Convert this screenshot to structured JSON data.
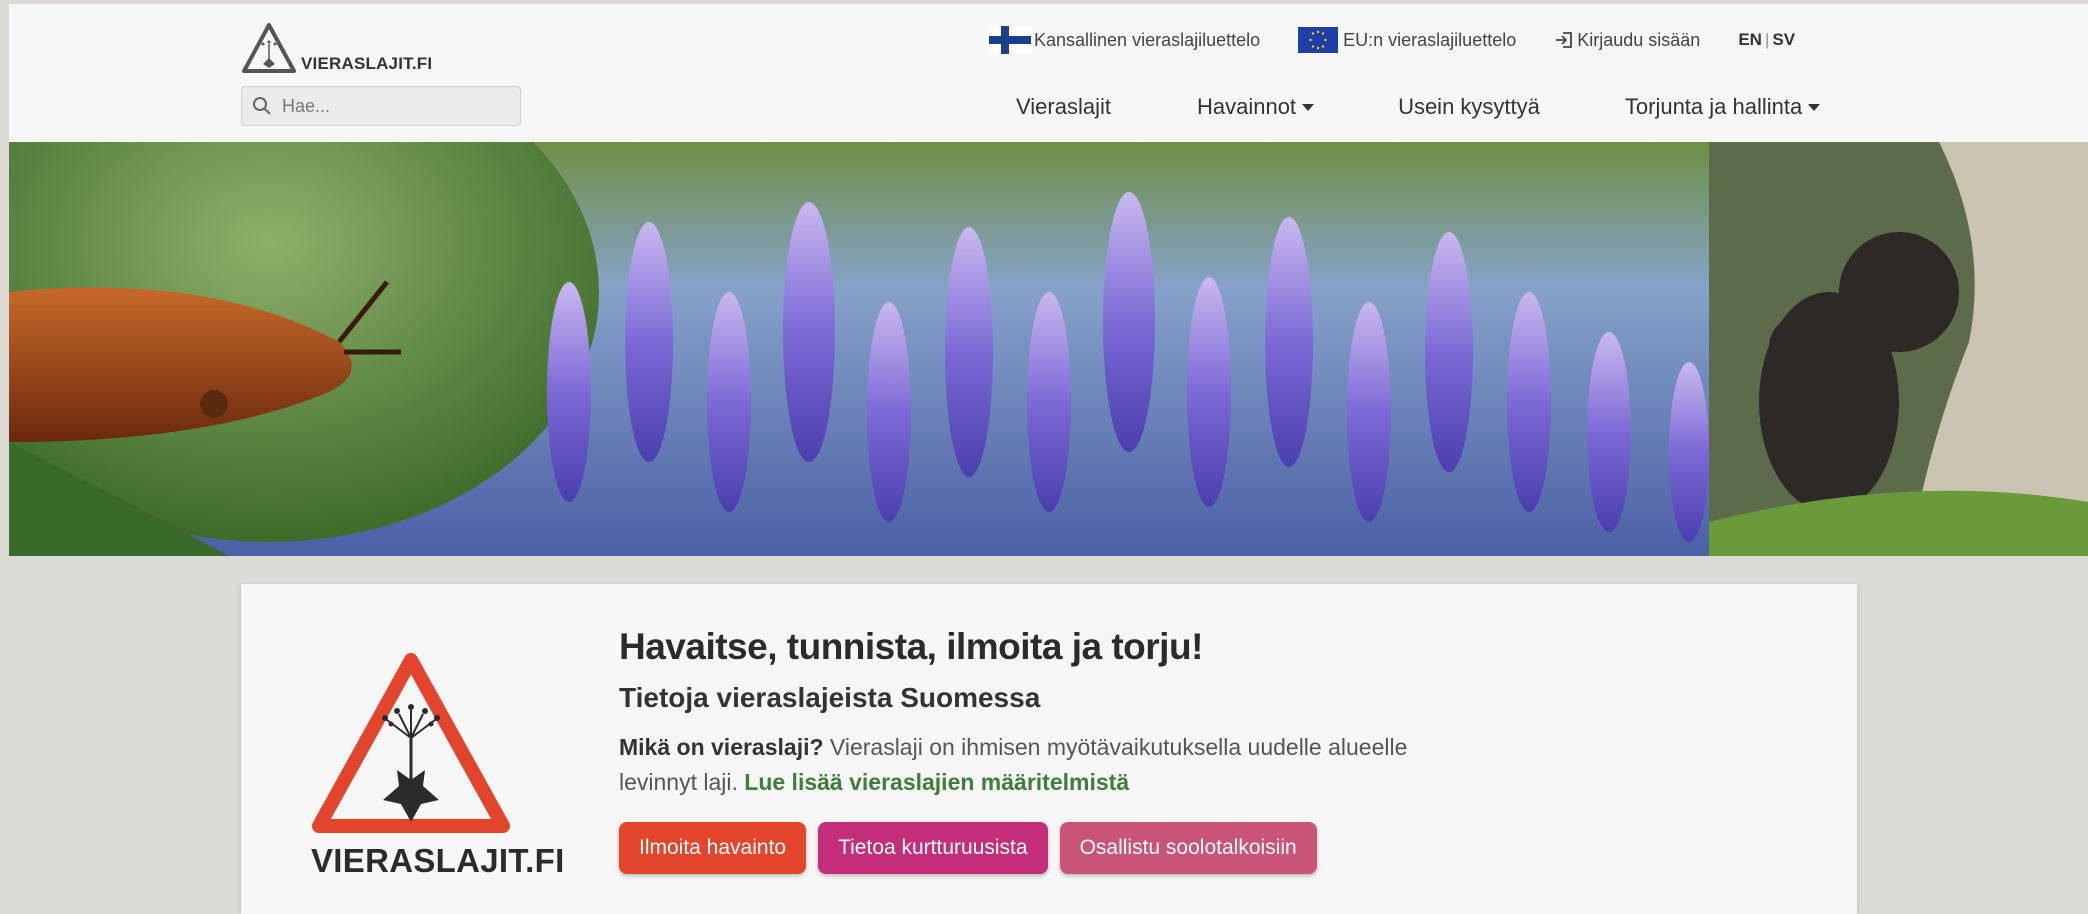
{
  "site": {
    "logo_text": "VIERASLAJIT.FI"
  },
  "search": {
    "placeholder": "Hae..."
  },
  "top_links": {
    "national": "Kansallinen vieraslajiluettelo",
    "eu": "EU:n vieraslajiluettelo",
    "login": "Kirjaudu sisään",
    "lang_en": "EN",
    "lang_sep": "|",
    "lang_sv": "SV"
  },
  "nav": {
    "species": "Vieraslajit",
    "observations": "Havainnot",
    "faq": "Usein kysyttyä",
    "control": "Torjunta ja hallinta"
  },
  "card": {
    "logo_text": "VIERASLAJIT.FI",
    "headline": "Havaitse, tunnista, ilmoita ja torju!",
    "subhead": "Tietoja vieraslajeista Suomessa",
    "question": "Mikä on vieraslaji?",
    "definition": " Vieraslaji on ihmisen myötävaikutuksella uudelle alueelle levinnyt laji. ",
    "link": "Lue lisää vieraslajien määritelmistä",
    "buttons": {
      "report": "Ilmoita havainto",
      "slug": "Tietoa kurtturuusista",
      "join": "Osallistu soolotalkoisiin"
    }
  },
  "colors": {
    "btn_report": "#e2452c",
    "btn_slug": "#c42e78",
    "btn_join": "#c95576",
    "link_green": "#3e7d3a",
    "warning_red": "#e2452c"
  },
  "icons": {
    "search": "search-icon",
    "login": "login-icon",
    "flag_fi": "finland-flag-icon",
    "flag_eu": "eu-flag-icon"
  }
}
